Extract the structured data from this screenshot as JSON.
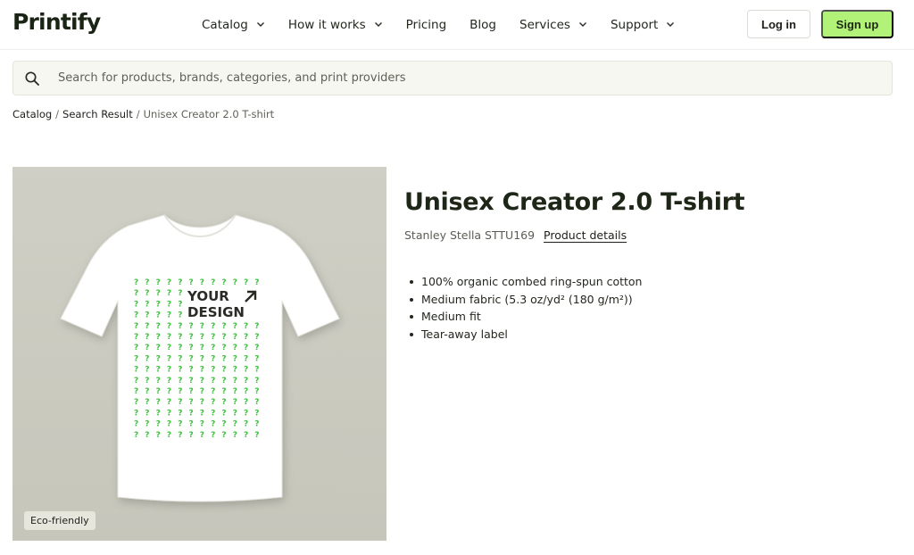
{
  "header": {
    "logo": "Printify",
    "nav": [
      {
        "label": "Catalog",
        "has_dropdown": true
      },
      {
        "label": "How it works",
        "has_dropdown": true
      },
      {
        "label": "Pricing",
        "has_dropdown": false
      },
      {
        "label": "Blog",
        "has_dropdown": false
      },
      {
        "label": "Services",
        "has_dropdown": true
      },
      {
        "label": "Support",
        "has_dropdown": true
      }
    ],
    "login_label": "Log in",
    "signup_label": "Sign up"
  },
  "search": {
    "placeholder": "Search for products, brands, categories, and print providers",
    "value": ""
  },
  "breadcrumb": {
    "items": [
      "Catalog",
      "Search Result"
    ],
    "current": "Unisex Creator 2.0 T-shirt"
  },
  "product": {
    "title": "Unisex Creator 2.0 T-shirt",
    "brand_model": "Stanley Stella STTU169",
    "details_link": "Product details",
    "features": [
      "100% organic combed ring-spun cotton",
      "Medium fabric (5.3 oz/yd² (180 g/m²))",
      "Medium fit",
      "Tear-away label"
    ],
    "badge": "Eco-friendly",
    "design_text_line1": "YOUR",
    "design_text_line2": "DESIGN"
  },
  "colors": {
    "accent": "#b3f279",
    "pattern": "#3fbf3f",
    "image_bg": "#cdcdc3",
    "shirt": "#ffffff"
  },
  "icons": {
    "search": "search-icon",
    "chevron": "chevron-down-icon",
    "arrow": "arrow-up-right-icon"
  }
}
